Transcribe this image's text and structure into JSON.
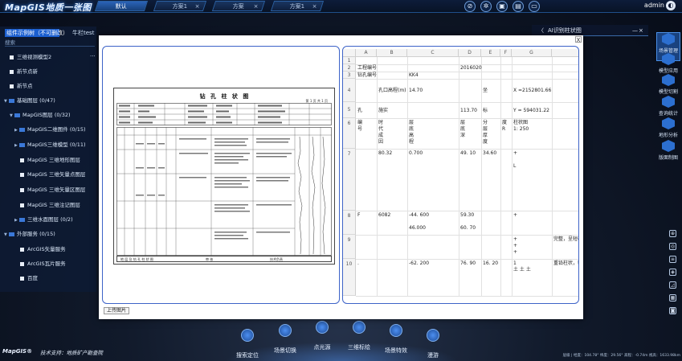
{
  "app": {
    "logo": "MapGIS地质一张图"
  },
  "top_tabs": [
    {
      "label": "默认",
      "active": true
    },
    {
      "label": "方案1",
      "active": false,
      "close": "×"
    },
    {
      "label": "方案",
      "active": false,
      "close": "×"
    },
    {
      "label": "方案1",
      "active": false,
      "close": "×"
    }
  ],
  "user": {
    "name": "admin"
  },
  "left_panel": {
    "tabs": [
      "组件示例树（不可删改）",
      "牛栏test"
    ],
    "search_placeholder": "搜索",
    "more": "···",
    "items": [
      {
        "label": "三维视测模型2",
        "depth": 0,
        "type": "layer"
      },
      {
        "label": "新节点新",
        "depth": 0,
        "type": "layer"
      },
      {
        "label": "新节点",
        "depth": 0,
        "type": "layer"
      },
      {
        "label": "基础图层 (0/47)",
        "depth": 0,
        "type": "folder"
      },
      {
        "label": "MapGIS图层 (0/32)",
        "depth": 1,
        "type": "folder"
      },
      {
        "label": "MapGIS二维图件 (0/15)",
        "depth": 2,
        "type": "folder"
      },
      {
        "label": "MapGIS三维模型 (0/11)",
        "depth": 2,
        "type": "folder"
      },
      {
        "label": "MapGIS 三维地形图层",
        "depth": 2,
        "type": "layer"
      },
      {
        "label": "MapGIS 三维矢量点图层",
        "depth": 2,
        "type": "layer"
      },
      {
        "label": "MapGIS 三维矢量区图层",
        "depth": 2,
        "type": "layer"
      },
      {
        "label": "MapGIS 三维注记图层",
        "depth": 2,
        "type": "layer"
      },
      {
        "label": "三维水面图层 (0/2)",
        "depth": 2,
        "type": "folder"
      },
      {
        "label": "外部服务 (0/15)",
        "depth": 0,
        "type": "folder"
      },
      {
        "label": "ArcGIS矢量服务",
        "depth": 1,
        "type": "layer"
      },
      {
        "label": "ArcGIS瓦片服务",
        "depth": 1,
        "type": "layer"
      },
      {
        "label": "百度",
        "depth": 1,
        "type": "layer"
      }
    ]
  },
  "right_title": {
    "chevron": "〈",
    "title": "AI识别柱状图",
    "min": "—",
    "close": "×"
  },
  "right_sidebar": [
    {
      "label": "场景管理",
      "active": true
    },
    {
      "label": "模型应用",
      "active": false
    },
    {
      "label": "模型切割",
      "active": false
    },
    {
      "label": "查询统计",
      "active": false
    },
    {
      "label": "地形分析",
      "active": false
    },
    {
      "label": "版面制图",
      "active": false
    }
  ],
  "bottom_nav": [
    "搜索定位",
    "场景切换",
    "点光源",
    "三维标绘",
    "场景特效",
    "漫游"
  ],
  "footer": {
    "logo": "MapGIS®",
    "tech": "技术支持：地质矿产勘查院",
    "status": "层级 | 经度：104.78° 纬度：29.56° 高程：-0.74m 视高：1633.98km"
  },
  "modal": {
    "close": "X",
    "upload_label": "上传图片",
    "doc": {
      "title": "钻 孔 柱 状 图",
      "sub": "第 1 页 共 1 页",
      "foot_left": "地 层 及 钻 孔 柱 状 图",
      "foot_mid": "审 核",
      "foot_right": "技术负责"
    },
    "sheet": {
      "columns": [
        "",
        "A",
        "B",
        "C",
        "D",
        "E",
        "F",
        "G"
      ],
      "rows": [
        {
          "n": "1",
          "cells": [
            "",
            "",
            "",
            "",
            "",
            "",
            ""
          ]
        },
        {
          "n": "2",
          "cells": [
            "工程编号",
            "",
            "",
            "2016020",
            "",
            "",
            ""
          ]
        },
        {
          "n": "3",
          "cells": [
            "钻孔编号",
            "",
            "KK4",
            "",
            "",
            "",
            ""
          ]
        },
        {
          "n": "4",
          "cells": [
            "",
            "孔口高程(m)",
            "14.70",
            "",
            "坐",
            "",
            "X =2152801.66"
          ]
        },
        {
          "n": "5",
          "cells": [
            "孔",
            "施实",
            "",
            "113.70",
            "标",
            "",
            "Y = 594031.22"
          ]
        },
        {
          "n": "6",
          "cells": [
            "编\n号",
            "时\n代\n成\n因",
            "层\n底\n高\n程",
            "层\n底\n深",
            "分\n层\n厚\n度",
            "度\nR",
            "柱状图\n1: 250"
          ]
        },
        {
          "n": "7",
          "cells": [
            "",
            "80.32",
            "0.700",
            "49. 10",
            "34.60",
            "",
            "+\n\nL"
          ]
        },
        {
          "n": "8",
          "cells": [
            "F",
            "6082",
            "-44. 600\n\n46.000",
            "59.30\n\n60. 70",
            "",
            "",
            "+"
          ]
        },
        {
          "n": "9",
          "cells": [
            "",
            "",
            "",
            "",
            "",
            "",
            "+\n+\n+"
          ]
        },
        {
          "n": "10",
          "cells": [
            ".",
            "",
            "-62. 200",
            "76. 90",
            "16. 20",
            "",
            "1\n土 土 土"
          ]
        }
      ],
      "overflow": {
        "r9": "完整，呈短柱",
        "r10": "重铅柱状，较"
      }
    }
  }
}
